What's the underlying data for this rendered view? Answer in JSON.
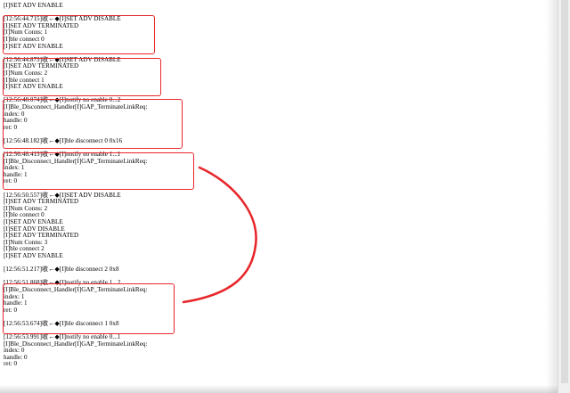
{
  "log_lines": [
    "[I]SET ADV ENABLE",
    "",
    "[12:56:44.715]收←◆[I]SET ADV DISABLE",
    "[I]SET ADV TERMINATED",
    "[I]Num Conns: 1",
    "[I]ble connect 0",
    "[I]SET ADV ENABLE",
    "",
    "[12:56:44.873]收←◆[I]SET ADV DISABLE",
    "[I]SET ADV TERMINATED",
    "[I]Num Conns: 2",
    "[I]ble connect 1",
    "[I]SET ADV ENABLE",
    "",
    "[12:56:48.074]收←◆[I]notify no enable 0...2",
    "[I]Ble_Disconnect_Handler[I]GAP_TerminateLinkReq:",
    "index: 0",
    "handle: 0",
    "ret: 0",
    "",
    "[12:56:48.182]收←◆[I]ble disconnect 0 0x16",
    "",
    "[12:56:48.413]收←◆[I]notify no enable 1...1",
    "[I]Ble_Disconnect_Handler[I]GAP_TerminateLinkReq:",
    "index: 1",
    "handle: 1",
    "ret: 0",
    "",
    "[12:56:50.557]收←◆[I]SET ADV DISABLE",
    "[I]SET ADV TERMINATED",
    "[I]Num Conns: 2",
    "[I]ble connect 0",
    "[I]SET ADV ENABLE",
    "[I]SET ADV DISABLE",
    "[I]SET ADV TERMINATED",
    "[I]Num Conns: 3",
    "[I]ble connect 2",
    "[I]SET ADV ENABLE",
    "",
    "[12:56:51.217]收←◆[I]ble disconnect 2 0x8",
    "",
    "[12:56:51.868]收←◆[I]notify no enable 1...2",
    "[I]Ble_Disconnect_Handler[I]GAP_TerminateLinkReq:",
    "index: 1",
    "handle: 1",
    "ret: 0",
    "",
    "[12:56:53.674]收←◆[I]ble disconnect 1 0x8",
    "",
    "[12:56:53.991]收←◆[I]notify no enable 0...1",
    "[I]Ble_Disconnect_Handler[I]GAP_TerminateLinkReq:",
    "index: 0",
    "handle: 0",
    "ret: 0"
  ],
  "colors": {
    "annotation": "#e8262a",
    "background": "#ffffff",
    "text": "#000000"
  }
}
